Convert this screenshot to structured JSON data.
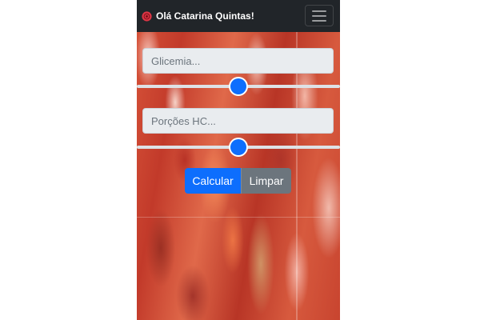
{
  "navbar": {
    "brand_text": "Olá Catarina Quintas!",
    "brand_icon": "red-circle-logo-icon",
    "menu_icon": "hamburger-menu-icon"
  },
  "form": {
    "glicemia": {
      "placeholder": "Glicemia...",
      "value": "",
      "slider_level_percent": 50
    },
    "porcoes": {
      "placeholder": "Porções HC...",
      "value": "",
      "slider_level_percent": 50
    }
  },
  "buttons": {
    "calcular_label": "Calcular",
    "limpar_label": "Limpar"
  },
  "colors": {
    "navbar": "#212529",
    "primary": "#0d6efd",
    "secondary": "#6c757d",
    "brand_icon": "#dc3545"
  }
}
